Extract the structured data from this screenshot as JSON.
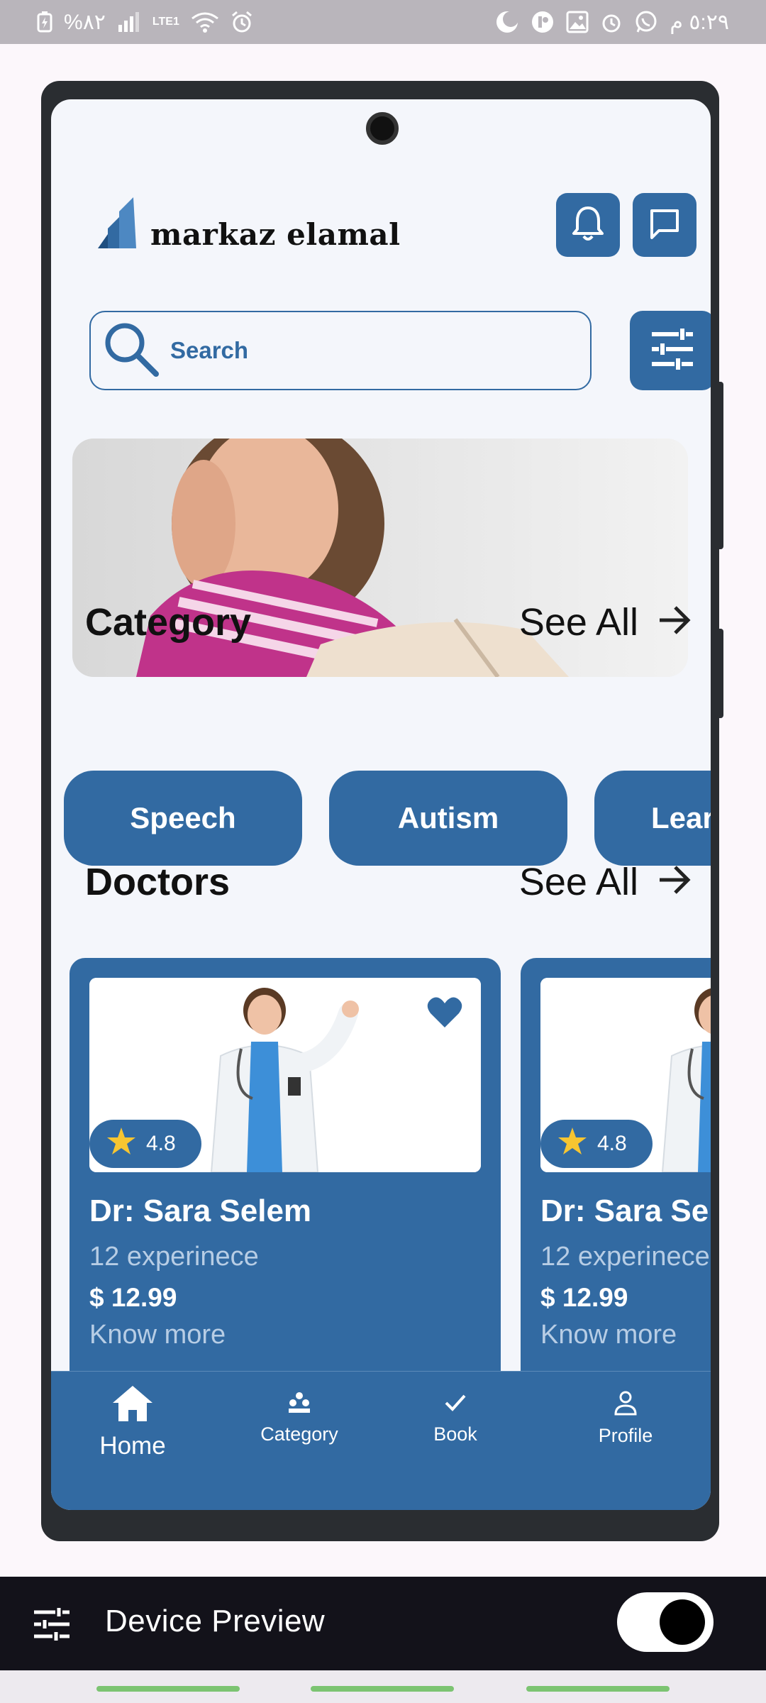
{
  "status_bar": {
    "left_text": "%٨٢",
    "network_label": "LTE1",
    "time": "٥:٢٩ م"
  },
  "app": {
    "logo_text": "markaz elamal",
    "search": {
      "placeholder": "Search"
    },
    "category_section": {
      "title": "Category",
      "see_all": "See All",
      "chips": [
        "Speech",
        "Autism",
        "Lear"
      ]
    },
    "doctors_section": {
      "title": "Doctors",
      "see_all": "See All",
      "doctors": [
        {
          "name": "Dr: Sara Selem",
          "experience": "12 experinece",
          "price": "$ 12.99",
          "more": "Know more",
          "rating": "4.8"
        },
        {
          "name": "Dr: Sara Se",
          "experience": "12 experinece",
          "price": "$ 12.99",
          "more": "Know more",
          "rating": "4.8"
        }
      ]
    },
    "bottom_nav": [
      {
        "label": "Home",
        "icon": "home-icon"
      },
      {
        "label": "Category",
        "icon": "category-icon"
      },
      {
        "label": "Book",
        "icon": "check-icon"
      },
      {
        "label": "Profile",
        "icon": "person-icon"
      }
    ]
  },
  "device_preview": {
    "title": "Device Preview",
    "enabled": true
  },
  "colors": {
    "primary": "#326aa2",
    "screen_bg": "#f4f6fb",
    "accent_star": "#f7c531"
  }
}
